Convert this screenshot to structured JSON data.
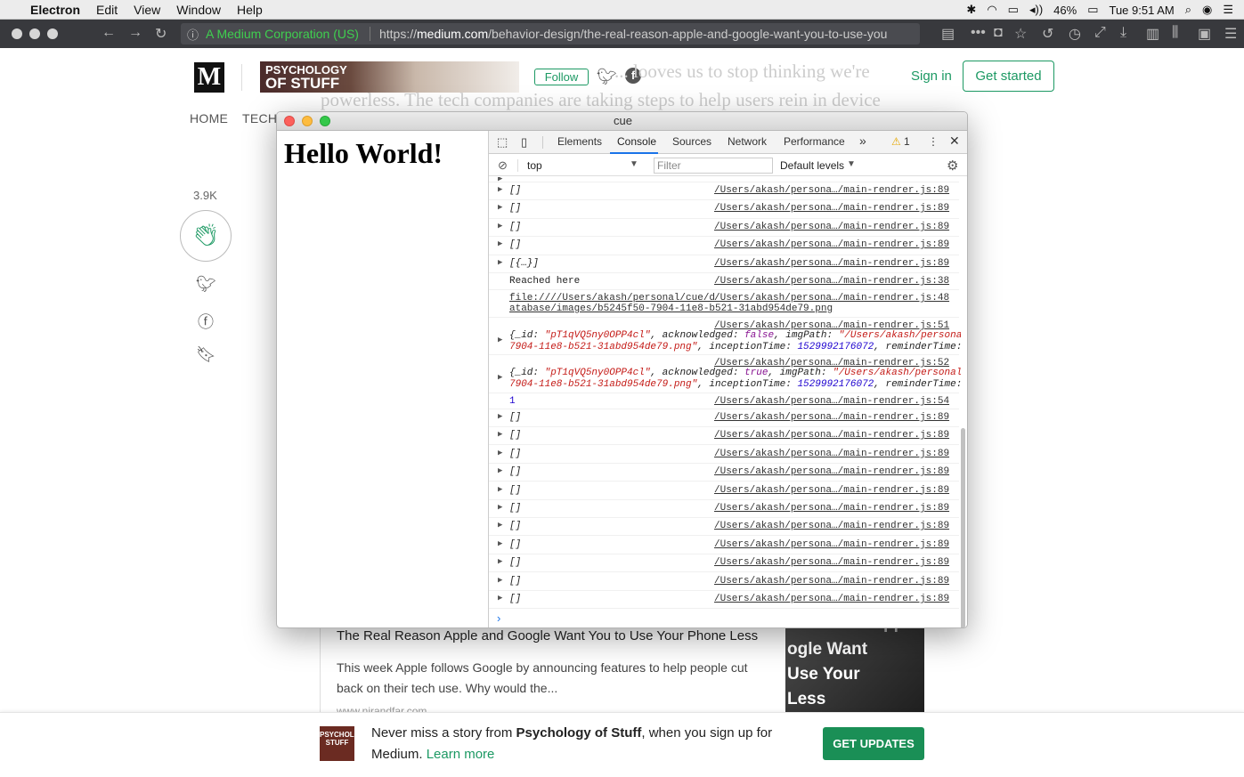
{
  "menubar": {
    "app": "Electron",
    "items": [
      "Edit",
      "View",
      "Window",
      "Help"
    ],
    "battery": "46%",
    "clock": "Tue 9:51 AM"
  },
  "browser": {
    "secure_label": "A Medium Corporation (US)",
    "url_prefix": "https://",
    "url_host": "medium.com",
    "url_path": "/behavior-design/the-real-reason-apple-and-google-want-you-to-use-you"
  },
  "medium": {
    "logo": "M",
    "banner_line1": "PSYCHOLOGY",
    "banner_line2": "OF STUFF",
    "follow": "Follow",
    "signin": "Sign in",
    "get_started": "Get started",
    "nav_home": "HOME",
    "nav_tech": "TECH",
    "bg_line1": "... looves us to stop thinking we're",
    "bg_line2": "powerless.  The tech companies are taking steps to help users rein in device",
    "clap_count": "3.9K",
    "card_title": "The Real Reason Apple and Google Want You to Use Your Phone Less",
    "card_desc": "This week Apple follows Google by announcing features to help people cut back on their tech use. Why would the...",
    "card_url": "www.nirandfar.com",
    "card_img_lines": [
      "al Reason Apple",
      "ogle Want",
      "Use Your",
      "Less"
    ],
    "bottom_thumb": "PSYCHOLOGY STUFF",
    "bottom_text_a": "Never miss a story from ",
    "bottom_text_b": "Psychology of Stuff",
    "bottom_text_c": ", when you sign up for Medium. ",
    "learn_more": "Learn more",
    "get_updates": "GET UPDATES"
  },
  "window": {
    "title": "cue",
    "hello": "Hello World!"
  },
  "devtools": {
    "tabs": [
      "Elements",
      "Console",
      "Sources",
      "Network",
      "Performance"
    ],
    "more": "»",
    "warnings": "1",
    "context": "top",
    "filter_placeholder": "Filter",
    "levels": "Default levels",
    "src89": "/Users/akash/persona…/main-rendrer.js:89",
    "rows_top": [
      "[]",
      "[]",
      "[]",
      "[]",
      "[{…}]"
    ],
    "reached": "Reached here",
    "src38": "/Users/akash/persona…/main-rendrer.js:38",
    "file_line1": "file:////Users/akash/personal/cue/d",
    "file_line2": "atabase/images/b5245f50-7904-11e8-b521-31abd954de79.png",
    "src48": "/Users/akash/persona…/main-rendrer.js:48",
    "src51": "/Users/akash/persona…/main-rendrer.js:51",
    "src52": "/Users/akash/persona…/main-rendrer.js:52",
    "src54": "/Users/akash/persona…/main-rendrer.js:54",
    "obj_id": "\"pT1qVQ5ny0OPP4cl\"",
    "obj1_ack": "false",
    "obj2_ack": "true",
    "obj_path_a": "\"/Users/akash/personal/",
    "obj_path_b": "7904-11e8-b521-31abd954de79.png\"",
    "obj_time": "1529992176072",
    "one": "1",
    "rows_bottom": [
      "[]",
      "[]",
      "[]",
      "[]",
      "[]",
      "[]",
      "[]",
      "[]",
      "[]",
      "[]",
      "[]"
    ]
  }
}
